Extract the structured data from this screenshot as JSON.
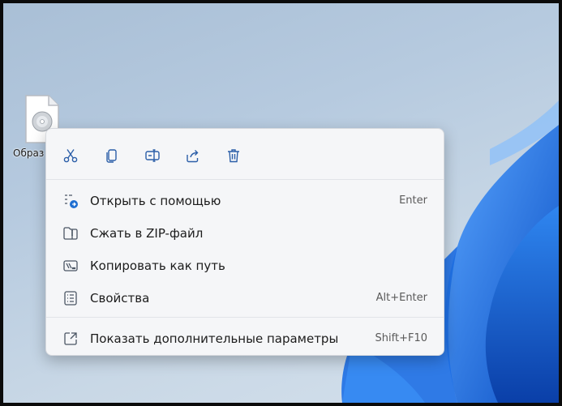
{
  "desktop": {
    "file_label": "Образ"
  },
  "context_menu": {
    "toolbar": [
      {
        "icon": "cut-icon"
      },
      {
        "icon": "copy-icon"
      },
      {
        "icon": "rename-icon"
      },
      {
        "icon": "share-icon"
      },
      {
        "icon": "delete-icon"
      }
    ],
    "items": [
      {
        "label": "Открыть с помощью",
        "shortcut": "Enter",
        "icon": "open-with-icon"
      },
      {
        "label": "Сжать в ZIP-файл",
        "shortcut": "",
        "icon": "zip-icon"
      },
      {
        "label": "Копировать как путь",
        "shortcut": "",
        "icon": "copy-path-icon"
      },
      {
        "label": "Свойства",
        "shortcut": "Alt+Enter",
        "icon": "properties-icon"
      }
    ],
    "more_options": {
      "label": "Показать дополнительные параметры",
      "shortcut": "Shift+F10",
      "icon": "more-options-icon"
    }
  },
  "colors": {
    "menu_background": "#f5f6f8",
    "icon_accent": "#1f6fd1",
    "bloom": "#1565d8"
  }
}
